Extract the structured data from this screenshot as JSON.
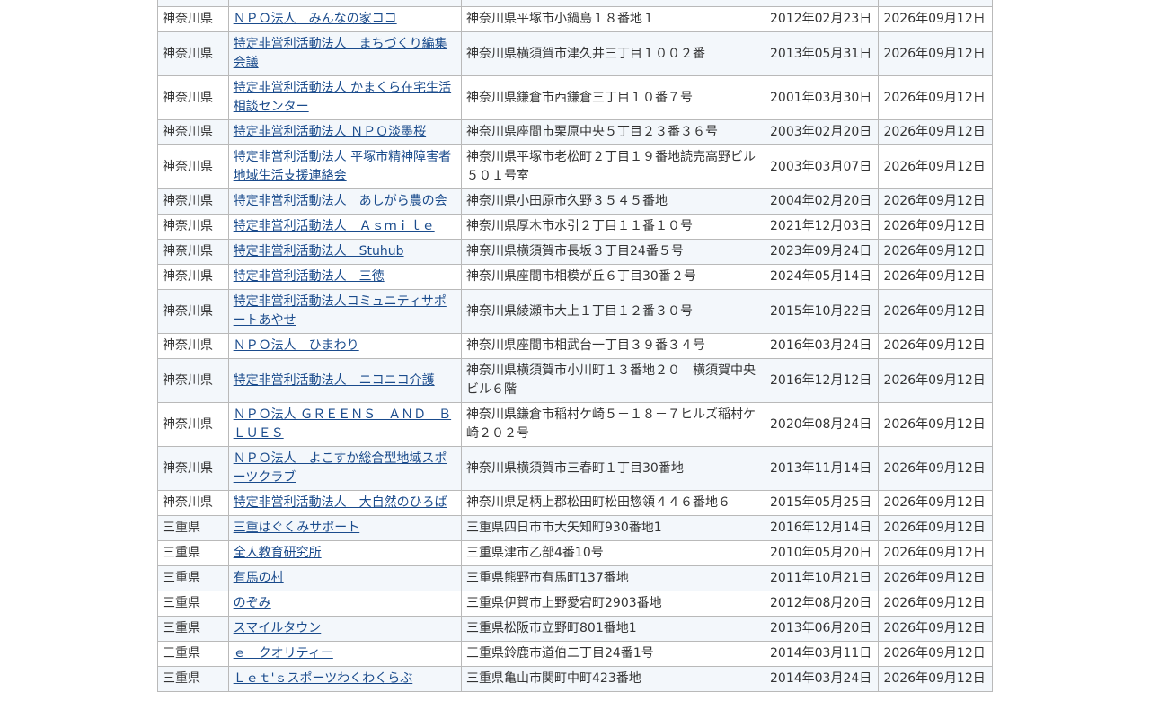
{
  "rows": [
    {
      "pref": "",
      "name": "",
      "address": "",
      "date1": "",
      "date2": ""
    },
    {
      "pref": "神奈川県",
      "name": "ＮＰＯ法人　みんなの家ココ",
      "address": "神奈川県平塚市小鍋島１８番地１",
      "date1": "2012年02月23日",
      "date2": "2026年09月12日"
    },
    {
      "pref": "神奈川県",
      "name": "特定非営利活動法人　まちづくり編集会議",
      "address": "神奈川県横須賀市津久井三丁目１００２番",
      "date1": "2013年05月31日",
      "date2": "2026年09月12日"
    },
    {
      "pref": "神奈川県",
      "name": "特定非営利活動法人 かまくら在宅生活相談センター",
      "address": "神奈川県鎌倉市西鎌倉三丁目１０番７号",
      "date1": "2001年03月30日",
      "date2": "2026年09月12日"
    },
    {
      "pref": "神奈川県",
      "name": "特定非営利活動法人 ＮＰＯ淡墨桜",
      "address": "神奈川県座間市栗原中央５丁目２３番３６号",
      "date1": "2003年02月20日",
      "date2": "2026年09月12日"
    },
    {
      "pref": "神奈川県",
      "name": "特定非営利活動法人 平塚市精神障害者地域生活支援連絡会",
      "address": "神奈川県平塚市老松町２丁目１９番地読売高野ビル５０１号室",
      "date1": "2003年03月07日",
      "date2": "2026年09月12日"
    },
    {
      "pref": "神奈川県",
      "name": "特定非営利活動法人　あしがら農の会",
      "address": "神奈川県小田原市久野３５４５番地",
      "date1": "2004年02月20日",
      "date2": "2026年09月12日"
    },
    {
      "pref": "神奈川県",
      "name": "特定非営利活動法人　Ａｓｍｉｌｅ",
      "address": "神奈川県厚木市水引２丁目１１番１０号",
      "date1": "2021年12月03日",
      "date2": "2026年09月12日"
    },
    {
      "pref": "神奈川県",
      "name": "特定非営利活動法人　Stuhub",
      "address": "神奈川県横須賀市長坂３丁目24番５号",
      "date1": "2023年09月24日",
      "date2": "2026年09月12日"
    },
    {
      "pref": "神奈川県",
      "name": "特定非営利活動法人　三徳",
      "address": "神奈川県座間市相模が丘６丁目30番２号",
      "date1": "2024年05月14日",
      "date2": "2026年09月12日"
    },
    {
      "pref": "神奈川県",
      "name": "特定非営利活動法人コミュニティサポートあやせ",
      "address": "神奈川県綾瀬市大上１丁目１２番３０号",
      "date1": "2015年10月22日",
      "date2": "2026年09月12日"
    },
    {
      "pref": "神奈川県",
      "name": "ＮＰＯ法人　ひまわり",
      "address": "神奈川県座間市相武台一丁目３９番３４号",
      "date1": "2016年03月24日",
      "date2": "2026年09月12日"
    },
    {
      "pref": "神奈川県",
      "name": "特定非営利活動法人　ニコニコ介護",
      "address": "神奈川県横須賀市小川町１３番地２０　横須賀中央ビル６階",
      "date1": "2016年12月12日",
      "date2": "2026年09月12日"
    },
    {
      "pref": "神奈川県",
      "name": "ＮＰＯ法人 ＧＲＥＥＮＳ　ＡＮＤ　ＢＬＵＥＳ",
      "address": "神奈川県鎌倉市稲村ケ崎５－１８－７ヒルズ稲村ケ崎２０２号",
      "date1": "2020年08月24日",
      "date2": "2026年09月12日"
    },
    {
      "pref": "神奈川県",
      "name": "ＮＰＯ法人　よこすか総合型地域スポーツクラブ",
      "address": "神奈川県横須賀市三春町１丁目30番地",
      "date1": "2013年11月14日",
      "date2": "2026年09月12日"
    },
    {
      "pref": "神奈川県",
      "name": "特定非営利活動法人　大自然のひろば",
      "address": "神奈川県足柄上郡松田町松田惣領４４６番地６",
      "date1": "2015年05月25日",
      "date2": "2026年09月12日"
    },
    {
      "pref": "三重県",
      "name": "三重はぐくみサポート",
      "address": "三重県四日市市大矢知町930番地1",
      "date1": "2016年12月14日",
      "date2": "2026年09月12日"
    },
    {
      "pref": "三重県",
      "name": "全人教育研究所",
      "address": "三重県津市乙部4番10号",
      "date1": "2010年05月20日",
      "date2": "2026年09月12日"
    },
    {
      "pref": "三重県",
      "name": "有馬の村",
      "address": "三重県熊野市有馬町137番地",
      "date1": "2011年10月21日",
      "date2": "2026年09月12日"
    },
    {
      "pref": "三重県",
      "name": "のぞみ",
      "address": "三重県伊賀市上野愛宕町2903番地",
      "date1": "2012年08月20日",
      "date2": "2026年09月12日"
    },
    {
      "pref": "三重県",
      "name": "スマイルタウン",
      "address": "三重県松阪市立野町801番地1",
      "date1": "2013年06月20日",
      "date2": "2026年09月12日"
    },
    {
      "pref": "三重県",
      "name": "ｅ－クオリティー",
      "address": "三重県鈴鹿市道伯二丁目24番1号",
      "date1": "2014年03月11日",
      "date2": "2026年09月12日"
    },
    {
      "pref": "三重県",
      "name": "Ｌｅｔ'ｓスポーツわくわくらぶ",
      "address": "三重県亀山市関町中町423番地",
      "date1": "2014年03月24日",
      "date2": "2026年09月12日"
    }
  ]
}
